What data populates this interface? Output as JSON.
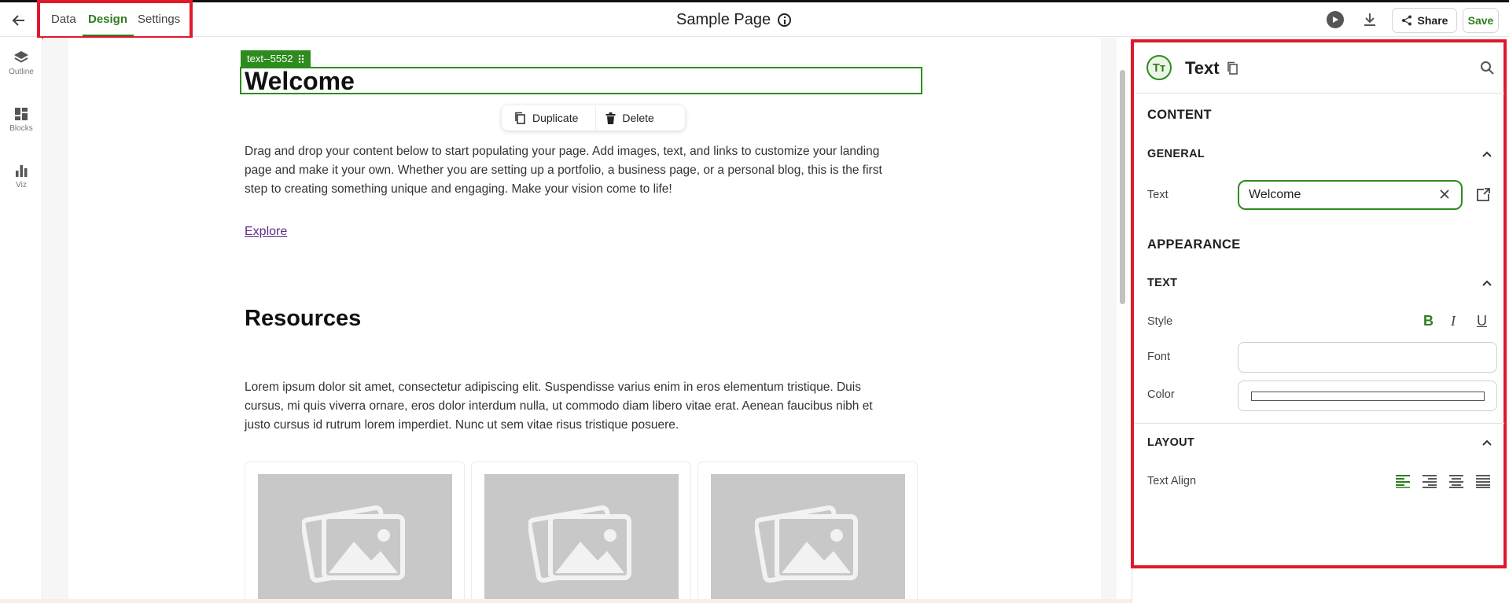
{
  "topbar": {
    "tabs": [
      {
        "label": "Data",
        "active": false
      },
      {
        "label": "Design",
        "active": true
      },
      {
        "label": "Settings",
        "active": false
      }
    ],
    "page_title": "Sample Page",
    "share_label": "Share",
    "save_label": "Save"
  },
  "rail": {
    "items": [
      {
        "label": "Outline",
        "icon": "layers-icon"
      },
      {
        "label": "Blocks",
        "icon": "blocks-icon"
      },
      {
        "label": "Viz",
        "icon": "bar-chart-icon"
      }
    ]
  },
  "canvas": {
    "selection_tag": "text--5552",
    "heading": "Welcome",
    "toolbar": {
      "duplicate_label": "Duplicate",
      "delete_label": "Delete"
    },
    "intro_paragraph_lines": [
      "Drag and drop your content below to start populating your page. Add images, text, and links to customize your landing",
      "page and make it your own. Whether you are setting up a portfolio, a business page, or a personal blog, this is the first",
      "step to creating something unique and engaging. Make your vision come to life!"
    ],
    "explore_link": "Explore",
    "resources_heading": "Resources",
    "resources_paragraph_lines": [
      "Lorem ipsum dolor sit amet, consectetur adipiscing elit. Suspendisse varius enim in eros elementum tristique. Duis",
      "cursus, mi quis viverra ornare, eros dolor interdum nulla, ut commodo diam libero vitae erat. Aenean faucibus nibh et",
      "justo cursus id rutrum lorem imperdiet. Nunc ut sem vitae risus tristique posuere."
    ],
    "cards": [
      {
        "icon": "image-placeholder-icon"
      },
      {
        "icon": "image-placeholder-icon"
      },
      {
        "icon": "image-placeholder-icon"
      }
    ]
  },
  "panel": {
    "title": "Text",
    "icon_glyph": "Tт",
    "content_heading": "CONTENT",
    "general_heading": "GENERAL",
    "text_label": "Text",
    "text_value": "Welcome",
    "appearance_heading": "APPEARANCE",
    "text_section_heading": "TEXT",
    "style_label": "Style",
    "style_buttons": {
      "bold": "B",
      "italic": "I",
      "underline": "U"
    },
    "font_label": "Font",
    "font_value": "",
    "color_label": "Color",
    "layout_heading": "LAYOUT",
    "text_align_label": "Text Align",
    "active_align": "left"
  },
  "colors": {
    "accent": "#2e7d1e",
    "highlight_box": "#e0192b",
    "link": "#5b2d86",
    "placeholder_gray": "#c8c8c8"
  }
}
